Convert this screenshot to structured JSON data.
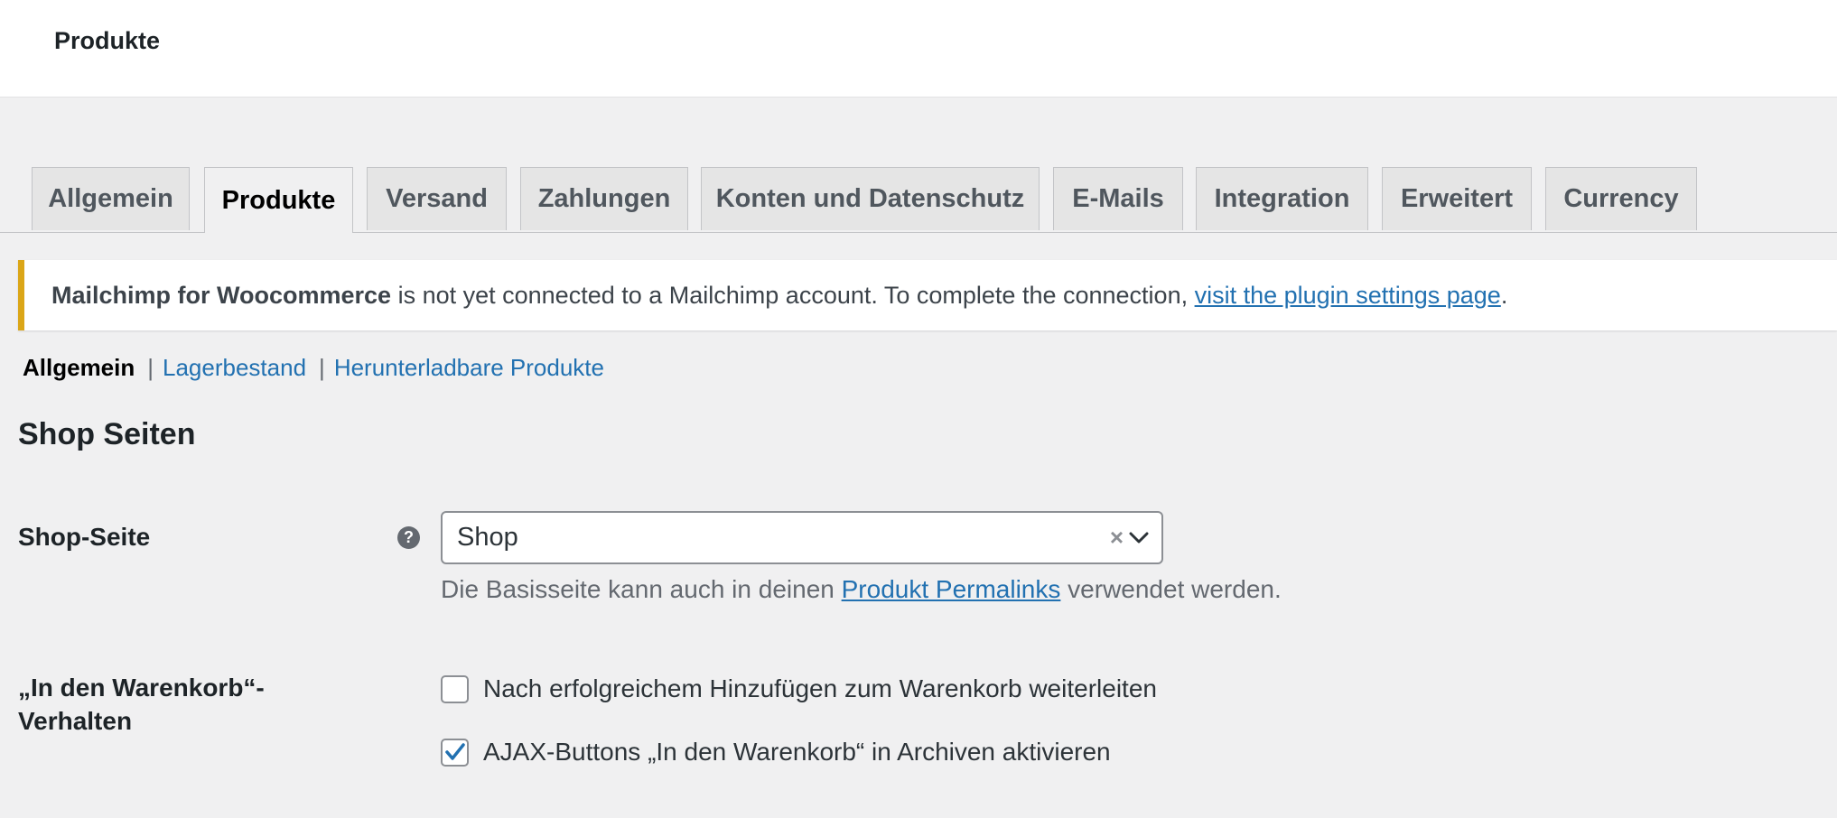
{
  "page": {
    "title": "Produkte"
  },
  "tabs": [
    {
      "label": "Allgemein",
      "active": false
    },
    {
      "label": "Produkte",
      "active": true
    },
    {
      "label": "Versand",
      "active": false
    },
    {
      "label": "Zahlungen",
      "active": false
    },
    {
      "label": "Konten und Datenschutz",
      "active": false
    },
    {
      "label": "E-Mails",
      "active": false
    },
    {
      "label": "Integration",
      "active": false
    },
    {
      "label": "Erweitert",
      "active": false
    },
    {
      "label": "Currency",
      "active": false
    }
  ],
  "notice": {
    "bold": "Mailchimp for Woocommerce",
    "text": " is not yet connected to a Mailchimp account. To complete the connection, ",
    "link": "visit the plugin settings page",
    "end": "."
  },
  "subsubsub": {
    "current": "Allgemein",
    "links": [
      "Lagerbestand",
      "Herunterladbare Produkte"
    ],
    "separator": "|"
  },
  "section": {
    "title": "Shop Seiten"
  },
  "shop_page": {
    "label": "Shop-Seite",
    "help_glyph": "?",
    "selected": "Shop",
    "clear_glyph": "×",
    "desc_before": "Die Basisseite kann auch in deinen ",
    "desc_link": "Produkt Permalinks",
    "desc_after": " verwendet werden."
  },
  "cart_behavior": {
    "label_line1": "„In den Warenkorb“-",
    "label_line2": "Verhalten",
    "options": [
      {
        "label": "Nach erfolgreichem Hinzufügen zum Warenkorb weiterleiten",
        "checked": false
      },
      {
        "label": "AJAX-Buttons „In den Warenkorb“ in Archiven aktivieren",
        "checked": true
      }
    ]
  },
  "colors": {
    "accent": "#2271b1",
    "notice_border": "#dba617",
    "background": "#f0f0f1"
  }
}
